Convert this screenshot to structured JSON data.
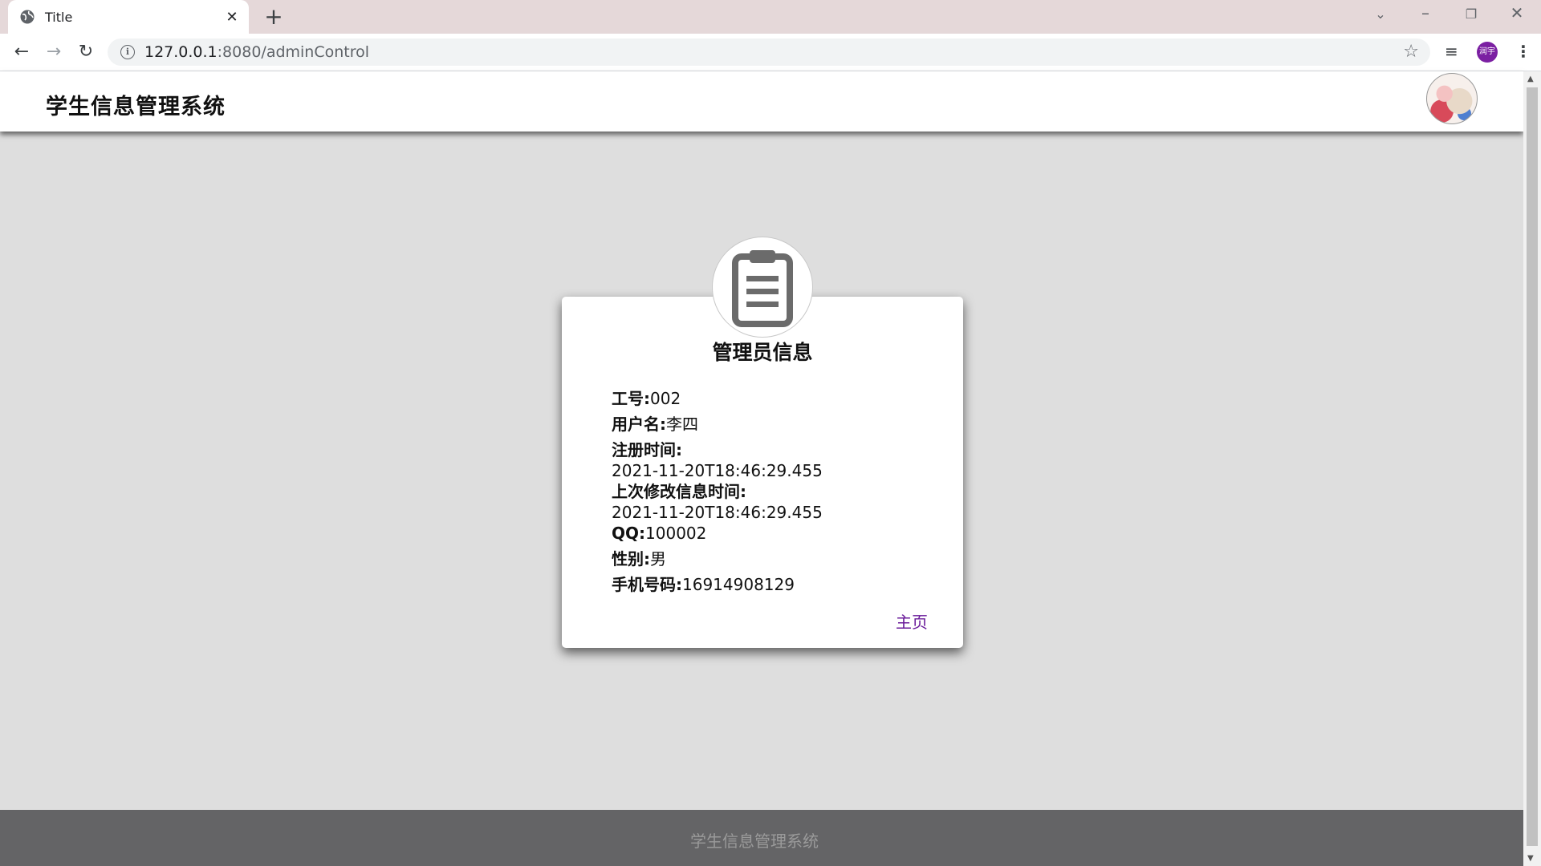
{
  "browser": {
    "tab_title": "Title",
    "url_host": "127.0.0.1",
    "url_rest": ":8080/adminControl",
    "profile_label": "润宇"
  },
  "header": {
    "site_title": "学生信息管理系统"
  },
  "card": {
    "title": "管理员信息",
    "fields": {
      "work_id_label": "工号:",
      "work_id_value": "002",
      "username_label": "用户名:",
      "username_value": "李四",
      "register_label": "注册时间:",
      "register_value": "2021-11-20T18:46:29.455",
      "modified_label": "上次修改信息时间:",
      "modified_value": "2021-11-20T18:46:29.455",
      "qq_label": "QQ:",
      "qq_value": "100002",
      "gender_label": "性别:",
      "gender_value": "男",
      "phone_label": "手机号码:",
      "phone_value": "16914908129"
    },
    "home_link": "主页",
    "badge_icon": "clipboard-icon"
  },
  "footer": {
    "text": "学生信息管理系统"
  },
  "colors": {
    "page_bg": "#dedede",
    "footer_bg": "#646466",
    "link": "#6a1b9a",
    "tabbar_bg": "#e5d8d9"
  }
}
